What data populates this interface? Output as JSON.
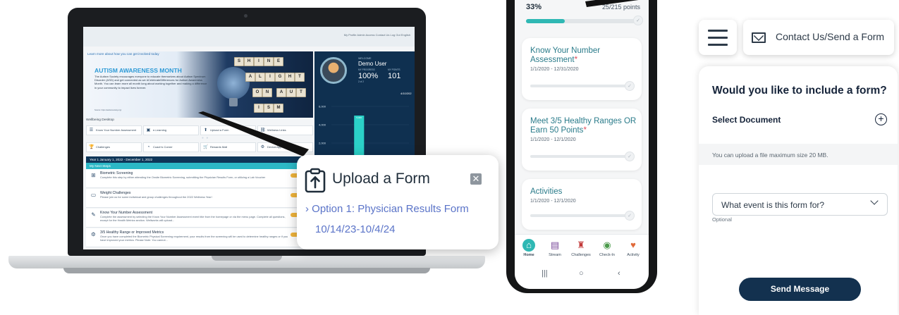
{
  "laptop": {
    "top_links": "My Profile  Admin Access  Contact Us  Log Out  English",
    "learn_more": "Learn more about how you can get involved today",
    "hero": {
      "title": "AUTISM AWARENESS MONTH",
      "text": "The Autism Society encourages everyone to educate themselves about Autism Spectrum Disorder (ASD) and get connected as we #CelebrateDifferences for Autism Awareness Month. You can learn more all month long about working together and making a difference in your community to impact lives forever.",
      "source": "Source: https://autismsociety.org/",
      "cubes": [
        "S",
        "H",
        "I",
        "N",
        "E",
        "A",
        "L",
        "I",
        "G",
        "H",
        "T",
        "O",
        "N",
        "A",
        "U",
        "T",
        "I",
        "S",
        "M"
      ]
    },
    "stats": {
      "welcome": "WELCOME",
      "name": "Demo User",
      "progress_label": "MY PROGRESS",
      "progress_value": "100%",
      "progress_sub": "2 of 2",
      "points_label": "MY POINTS",
      "points_value": "101",
      "date": "4/10/202"
    },
    "chart_data": {
      "type": "bar",
      "categories": [
        "SUN",
        "MON",
        "TUE",
        "WED",
        "THU",
        "FRI",
        "SA"
      ],
      "values": [
        0,
        0,
        5000,
        0,
        0,
        0,
        0
      ],
      "ylim": [
        0,
        6000
      ],
      "yticks": [
        "6,000",
        "4,000",
        "2,000"
      ],
      "bar_label": "5,000",
      "legend": "Steps  Active Minutes  Blood Pressure  Glucose",
      "bar_color": "#2bd1c8"
    },
    "wellbeing_header": "Wellbeing Desktop",
    "wellbeing_row1": [
      {
        "icon": "☰",
        "name": "know-your-number",
        "label": "Know Your Number Assessment"
      },
      {
        "icon": "▣",
        "name": "e-learning",
        "label": "e-Learning"
      },
      {
        "icon": "⬆",
        "name": "upload-form",
        "label": "Upload a Form"
      },
      {
        "icon": "⛓",
        "name": "wellness-links",
        "label": "Wellness Links"
      }
    ],
    "wellbeing_row2": [
      {
        "icon": "🏆",
        "name": "challenges",
        "label": "Challenges"
      },
      {
        "icon": "◔",
        "name": "coachs-corner",
        "label": "Coach's Corner"
      },
      {
        "icon": "🛒",
        "name": "rewards-mall",
        "label": "Rewards Mall"
      },
      {
        "icon": "⚙",
        "name": "device-app",
        "label": "Device/App Conn"
      }
    ],
    "year_bar": "Year 1 January 1, 2022 - December 1, 2022",
    "steps_bar": "My Next Steps",
    "steps_done": "0 Tasks Do",
    "tasks": [
      {
        "icon": "⊞",
        "title": "Biometric Screening",
        "desc": "Complete this step by either attending the Onsite Biometric Screening, submitting the Physician Results Form, or utilizing a Lab Voucher"
      },
      {
        "icon": "▭",
        "title": "Weight Challenges",
        "desc": "Please join us for some individual and group challenges throughout the 2022 Wellness Year!"
      },
      {
        "icon": "✎",
        "title": "Know Your Number Assessment",
        "desc": "Complete the assessment by selecting the Know Your Number Assessment event title from the homepage or via the menu page. Complete all questions, except for the Health Metrics section. Wellworks will upload..."
      },
      {
        "icon": "⚙",
        "title": "3/5 Healthy Range or Improved Metrics",
        "desc": "Once you have completed the Biometric Physical Screening requirement, your results from the screening will be used to determine healthy ranges or if you have improved your metrics.  Please Note: You cannot..."
      }
    ]
  },
  "upload_popup": {
    "title": "Upload a Form",
    "option": "› Option 1: Physician Results Form",
    "date": "10/14/23-10/4/24"
  },
  "phone": {
    "progress_pct": "33%",
    "progress_value": 0.33,
    "points": "25/215 points",
    "cards": [
      {
        "title": "Know Your Number Assessment",
        "star": "*",
        "date": "1/1/2020 - 12/31/2020"
      },
      {
        "title": "Meet 3/5 Healthy Ranges OR Earn 50 Points",
        "star": "*",
        "date": "1/1/2020 - 12/1/2020"
      },
      {
        "title": "Activities",
        "star": "",
        "date": "1/1/2020 - 12/1/2020"
      }
    ],
    "nav": [
      {
        "name": "home",
        "label": "Home",
        "icon": "⌂",
        "color": "#2fb8b4"
      },
      {
        "name": "stream",
        "label": "Stream",
        "icon": "▤",
        "color": "#7a4a9a"
      },
      {
        "name": "challenges",
        "label": "Challenges",
        "icon": "♜",
        "color": "#c23a3a"
      },
      {
        "name": "check-in",
        "label": "Check-In",
        "icon": "◉",
        "color": "#4a9a4a"
      },
      {
        "name": "activity",
        "label": "Activity",
        "icon": "♥",
        "color": "#e06a3a"
      }
    ],
    "sys": [
      "|||",
      "○",
      "‹"
    ]
  },
  "form_panel": {
    "contact_label": "Contact Us/Send a Form",
    "question": "Would you like to include a form?",
    "select_document": "Select Document",
    "info": "You can upload a file maximum size 20 MB.",
    "dropdown_label": "What event is this form for?",
    "optional": "Optional",
    "send_label": "Send Message"
  }
}
